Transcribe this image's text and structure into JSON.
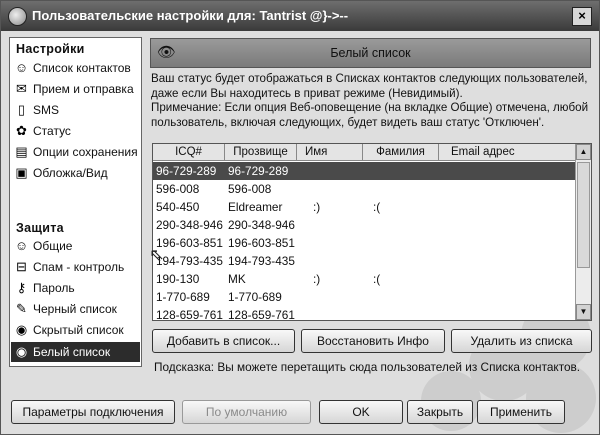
{
  "window": {
    "title": "Пользовательские настройки для: Tantrist @}->--",
    "close_glyph": "×"
  },
  "sidebar": {
    "settings_heading": "Настройки",
    "settings_items": [
      {
        "label": "Список контактов",
        "icon": "contacts-icon"
      },
      {
        "label": "Прием и отправка",
        "icon": "message-icon"
      },
      {
        "label": "SMS",
        "icon": "sms-icon"
      },
      {
        "label": "Статус",
        "icon": "status-icon"
      },
      {
        "label": "Опции сохранения",
        "icon": "save-options-icon"
      },
      {
        "label": "Обложка/Вид",
        "icon": "skin-icon"
      }
    ],
    "security_heading": "Защита",
    "security_items": [
      {
        "label": "Общие",
        "icon": "general-icon"
      },
      {
        "label": "Спам - контроль",
        "icon": "spam-icon"
      },
      {
        "label": "Пароль",
        "icon": "key-icon"
      },
      {
        "label": "Черный список",
        "icon": "blacklist-icon"
      },
      {
        "label": "Скрытый список",
        "icon": "hidden-list-icon"
      },
      {
        "label": "Белый список",
        "icon": "whitelist-icon",
        "selected": true
      }
    ]
  },
  "content": {
    "header_title": "Белый список",
    "description": [
      "Ваш статус будет отображаться в Списках контактов следующих пользователей,",
      "даже если Вы находитесь в приват режиме (Невидимый).",
      "Примечание: Если опция Веб-оповещение (на вкладке Общие) отмечена, любой",
      "пользователь, включая следующих, будет видеть ваш статус 'Отключен'."
    ],
    "columns": [
      "ICQ#",
      "Прозвище",
      "Имя",
      "Фамилия",
      "Email адрес"
    ],
    "rows": [
      {
        "icq": "96-729-289",
        "nick": "96-729-289",
        "name": "",
        "surname": "",
        "email": "",
        "selected": true
      },
      {
        "icq": "596-008",
        "nick": "596-008",
        "name": "",
        "surname": "",
        "email": ""
      },
      {
        "icq": "540-450",
        "nick": "Eldreamer",
        "name": ":)",
        "surname": ":(",
        "email": ""
      },
      {
        "icq": "290-348-946",
        "nick": "290-348-946",
        "name": "",
        "surname": "",
        "email": ""
      },
      {
        "icq": "196-603-851",
        "nick": "196-603-851",
        "name": "",
        "surname": "",
        "email": ""
      },
      {
        "icq": "194-793-435",
        "nick": "194-793-435",
        "name": "",
        "surname": "",
        "email": ""
      },
      {
        "icq": "190-130",
        "nick": "MK",
        "name": ":)",
        "surname": ":(",
        "email": ""
      },
      {
        "icq": "1-770-689",
        "nick": "1-770-689",
        "name": "",
        "surname": "",
        "email": ""
      },
      {
        "icq": "128-659-761",
        "nick": "128-659-761",
        "name": "",
        "surname": "",
        "email": ""
      }
    ],
    "buttons": {
      "add": "Добавить в список...",
      "restore": "Восстановить Инфо",
      "remove": "Удалить из списка"
    },
    "hint": "Подсказка: Вы можете перетащить сюда пользователей из Списка контактов."
  },
  "footer": {
    "connection": "Параметры подключения",
    "defaults": "По умолчанию",
    "ok": "OK",
    "close": "Закрыть",
    "apply": "Применить"
  }
}
